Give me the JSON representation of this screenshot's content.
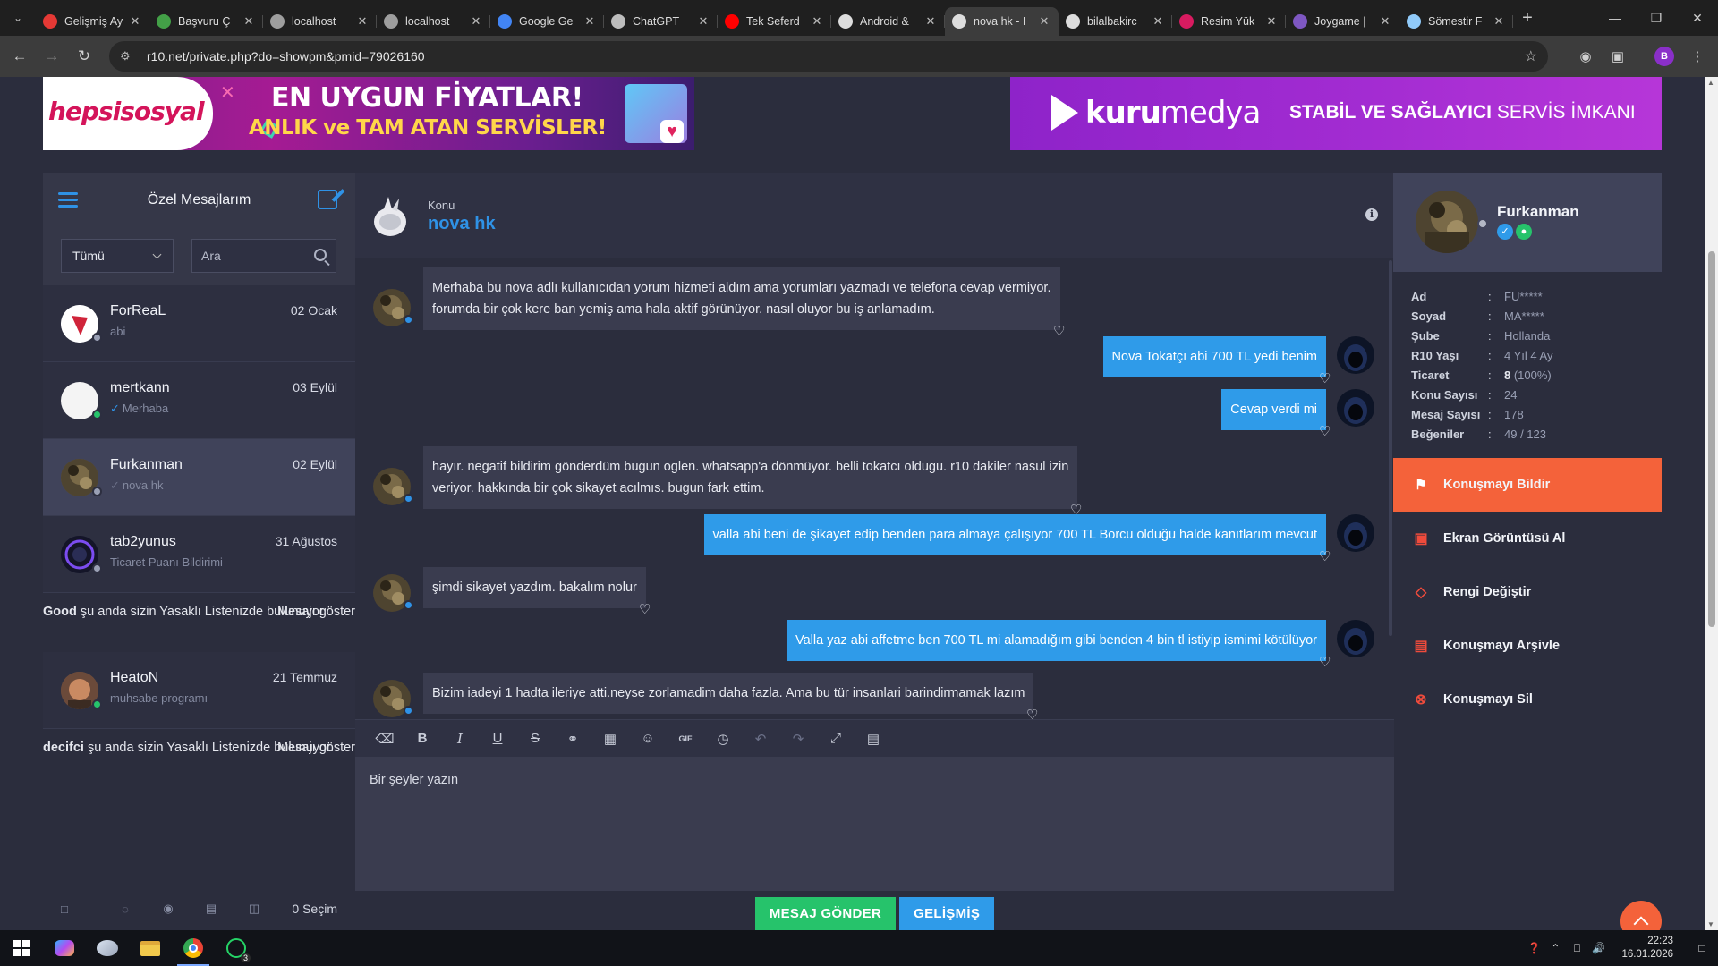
{
  "browser": {
    "tabs": [
      {
        "title": "Gelişmiş Ay",
        "color": "#e53935",
        "active": false
      },
      {
        "title": "Başvuru Ç",
        "color": "#43a047",
        "active": false
      },
      {
        "title": "localhost",
        "color": "#9e9e9e",
        "active": false
      },
      {
        "title": "localhost",
        "color": "#9e9e9e",
        "active": false
      },
      {
        "title": "Google Ge",
        "color": "#4285f4",
        "active": false
      },
      {
        "title": "ChatGPT",
        "color": "#bdbdbd",
        "active": false
      },
      {
        "title": "Tek Seferd",
        "color": "#ff0000",
        "active": false
      },
      {
        "title": "Android &",
        "color": "#dddddd",
        "active": false
      },
      {
        "title": "nova hk - I",
        "color": "#dddddd",
        "active": true
      },
      {
        "title": "bilalbakirc",
        "color": "#dddddd",
        "active": false
      },
      {
        "title": "Resim Yük",
        "color": "#d81b60",
        "active": false
      },
      {
        "title": "Joygame |",
        "color": "#7e57c2",
        "active": false
      },
      {
        "title": "Sömestir F",
        "color": "#90caf9",
        "active": false
      }
    ],
    "url": "r10.net/private.php?do=showpm&pmid=79026160",
    "profile_initial": "B"
  },
  "banners": {
    "left": {
      "logo": "hepsisosyal",
      "line1": "EN UYGUN FİYATLAR!",
      "line2": "ANLIK ve TAM ATAN SERVİSLER!"
    },
    "right": {
      "logo_bold": "kuru",
      "logo_rest": "medya",
      "slogan_bold": "STABİL VE SAĞLAYICI",
      "slogan_rest": " SERVİS İMKANI"
    }
  },
  "sidebar": {
    "title": "Özel Mesajlarım",
    "filter_value": "Tümü",
    "search_placeholder": "Ara",
    "conversations": [
      {
        "name": "ForReaL",
        "date": "02 Ocak",
        "preview": "abi",
        "status": "#9aa0b5",
        "avatar": "#ffffff"
      },
      {
        "name": "mertkann",
        "date": "03 Eylül",
        "preview": "Merhaba",
        "status": "#26c36b",
        "avatar": "#f4f4f4"
      },
      {
        "name": "Furkanman",
        "date": "02 Eylül",
        "preview": "nova hk",
        "status": "#9aa0b5",
        "avatar": "#6b5a3a"
      },
      {
        "name": "tab2yunus",
        "date": "31 Ağustos",
        "preview": "Ticaret Puanı Bildirimi",
        "status": "#9aa0b5",
        "avatar": "#1c1f3a"
      },
      {
        "name": "HeatoN",
        "date": "21 Temmuz",
        "preview": "muhsabe programı",
        "status": "#26c36b",
        "avatar": "#8a5a3c"
      }
    ],
    "blocked": [
      {
        "user": "Good",
        "text": " şu anda sizin Yasaklı Listenizde bulunuyor.",
        "action": "Mesajı göster"
      },
      {
        "user": "decifci",
        "text": " şu anda sizin Yasaklı Listenizde bulunuyor.",
        "action": "Mesajı göster"
      }
    ],
    "selection_count": "0 Seçim"
  },
  "topic": {
    "label": "Konu",
    "title": "nova hk"
  },
  "messages": [
    {
      "dir": "in",
      "lines": [
        "Merhaba bu nova adlı kullanıcıdan yorum hizmeti aldım ama yorumları yazmadı ve telefona cevap vermiyor.",
        "forumda bir çok kere ban yemiş ama hala aktif görünüyor. nasıl oluyor bu iş anlamadım."
      ]
    },
    {
      "dir": "out",
      "lines": [
        "Nova Tokatçı abi 700 TL yedi benim"
      ]
    },
    {
      "dir": "out",
      "lines": [
        "Cevap verdi mi"
      ]
    },
    {
      "dir": "in",
      "lines": [
        "hayır. negatif bildirim gönderdüm bugun oglen. whatsapp'a dönmüyor. belli tokatcı oldugu. r10 dakiler nasul izin",
        "veriyor. hakkında bir çok sikayet acılmıs. bugun fark ettim."
      ]
    },
    {
      "dir": "out",
      "lines": [
        "valla abi beni de şikayet edip benden para almaya çalışıyor 700 TL Borcu olduğu halde kanıtlarım mevcut"
      ]
    },
    {
      "dir": "in",
      "lines": [
        "şimdi sikayet yazdım. bakalım nolur"
      ]
    },
    {
      "dir": "out",
      "lines": [
        "Valla yaz abi affetme ben 700 TL mi alamadığım gibi benden 4 bin tl istiyip ismimi kötülüyor"
      ]
    },
    {
      "dir": "in",
      "lines": [
        "Bizim iadeyi 1 hadta ileriye atti.neyse zorlamadim daha fazla. Ama bu tür insanlari barindirmamak lazım"
      ]
    }
  ],
  "editor": {
    "placeholder": "Bir şeyler yazın",
    "send": "MESAJ GÖNDER",
    "advanced": "GELİŞMİŞ"
  },
  "profile": {
    "name": "Furkanman",
    "stats": [
      {
        "key": "Ad",
        "value": "FU*****"
      },
      {
        "key": "Soyad",
        "value": "MA*****"
      },
      {
        "key": "Şube",
        "value": "Hollanda"
      },
      {
        "key": "R10 Yaşı",
        "value": "4 Yıl 4 Ay"
      },
      {
        "key": "Ticaret",
        "value_bold": "8",
        "value": " (100%)"
      },
      {
        "key": "Konu Sayısı",
        "value": "24"
      },
      {
        "key": "Mesaj Sayısı",
        "value": "178"
      },
      {
        "key": "Beğeniler",
        "value": "49 / 123"
      }
    ],
    "actions": [
      {
        "label": "Konuşmayı Bildir",
        "icon": "flag-icon"
      },
      {
        "label": "Ekran Görüntüsü Al",
        "icon": "camera-icon"
      },
      {
        "label": "Rengi Değiştir",
        "icon": "drop-icon"
      },
      {
        "label": "Konuşmayı Arşivle",
        "icon": "archive-icon"
      },
      {
        "label": "Konuşmayı Sil",
        "icon": "delete-icon"
      }
    ]
  },
  "taskbar": {
    "time": "22:23",
    "date": "16.01.2026",
    "whatsapp_badge": "3"
  }
}
